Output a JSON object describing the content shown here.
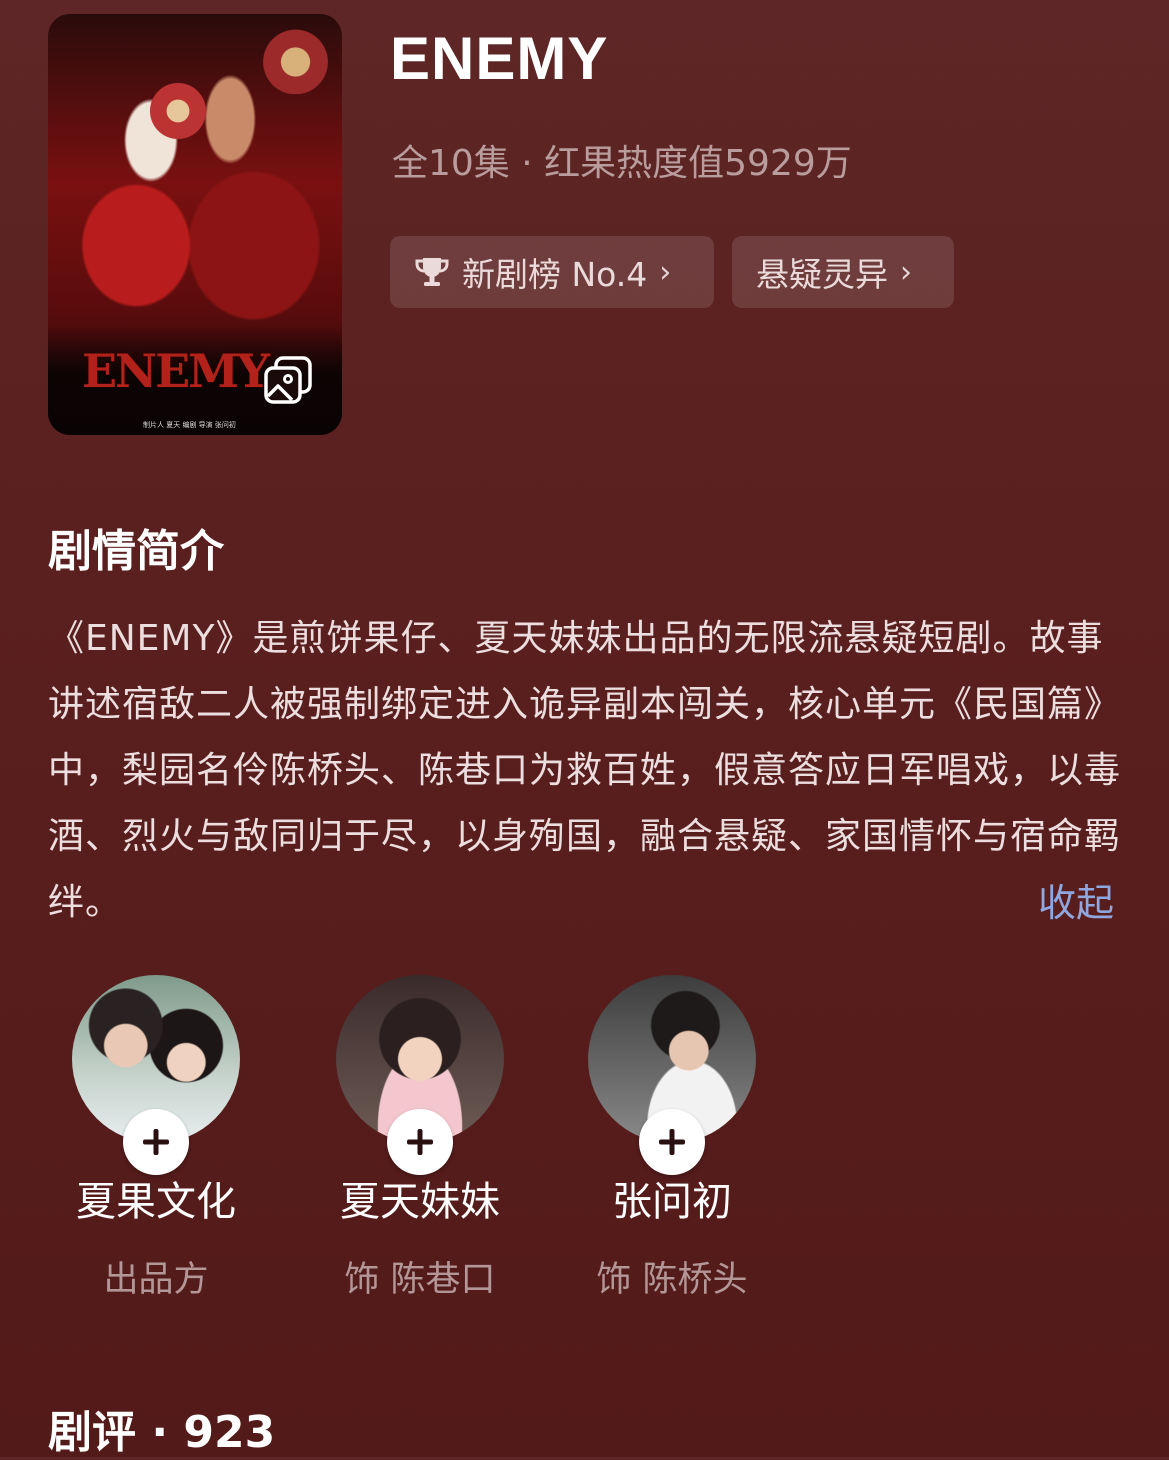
{
  "poster": {
    "title": "ENEMY",
    "credits": "制片人 夏天   编剧 导演 张问初",
    "gallery_icon": "gallery-icon"
  },
  "show": {
    "title": "ENEMY",
    "meta": "全10集 · 红果热度值5929万"
  },
  "chips": {
    "rank_icon": "trophy-icon",
    "rank_label": "新剧榜 No.4",
    "genre_label": "悬疑灵异",
    "chevron": "›"
  },
  "synopsis": {
    "heading": "剧情简介",
    "text": "《ENEMY》是煎饼果仔、夏天妹妹出品的无限流悬疑短剧。故事讲述宿敌二人被强制绑定进入诡异副本闯关，核心单元《民国篇》中，梨园名伶陈桥头、陈巷口为救百姓，假意答应日军唱戏，以毒酒、烈火与敌同归于尽，以身殉国，融合悬疑、家国情怀与宿命羁绊。",
    "collapse_label": "收起"
  },
  "cast": [
    {
      "name": "夏果文化",
      "role": "出品方"
    },
    {
      "name": "夏天妹妹",
      "role": "饰 陈巷口"
    },
    {
      "name": "张问初",
      "role": "饰 陈桥头"
    }
  ],
  "reviews": {
    "heading": "剧评 · 923"
  },
  "colors": {
    "background": "#5a1f1f",
    "accent_link": "#8fa6df",
    "chip_bg": "rgba(255,255,255,0.12)"
  }
}
